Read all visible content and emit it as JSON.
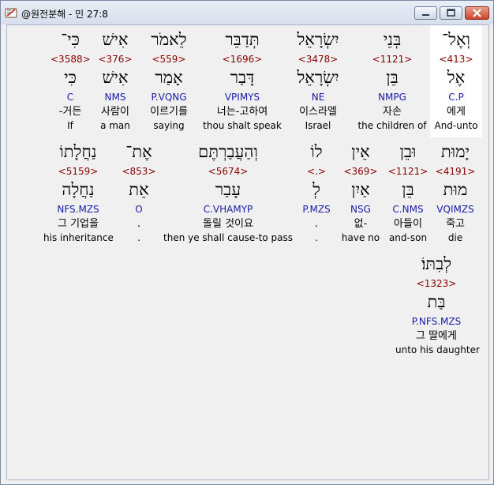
{
  "window": {
    "title": "@원전분해 - 민 27:8",
    "app_icon": "book-icon"
  },
  "rows": [
    {
      "words": [
        {
          "heb": "כִּי־",
          "num": "<3588>",
          "lemma": "כִּי",
          "morph": "C",
          "kor": "-거든",
          "eng": "If"
        },
        {
          "heb": "אִישׁ",
          "num": "<376>",
          "lemma": "אִישׁ",
          "morph": "NMS",
          "kor": "사람이",
          "eng": "a man"
        },
        {
          "heb": "לֵאמֹר",
          "num": "<559>",
          "lemma": "אָמַר",
          "morph": "P.VQNG",
          "kor": "이르기를",
          "eng": "saying"
        },
        {
          "heb": "תְּדַבֵּר",
          "num": "<1696>",
          "lemma": "דָּבַר",
          "morph": "VPIMYS",
          "kor": "너는-고하여",
          "eng": "thou shalt speak"
        },
        {
          "heb": "יִשְׂרָאֵל",
          "num": "<3478>",
          "lemma": "יִשְׂרָאֵל",
          "morph": "NE",
          "kor": "이스라엘",
          "eng": "Israel"
        },
        {
          "heb": "בְּנֵי",
          "num": "<1121>",
          "lemma": "בֵּן",
          "morph": "NMPG",
          "kor": "자손",
          "eng": "the children of"
        },
        {
          "heb": "וְאֶל־",
          "num": "<413>",
          "lemma": "אֶל",
          "morph": "C.P",
          "kor": "에게",
          "eng": "And-unto"
        }
      ]
    },
    {
      "words": [
        {
          "heb": "נַחֲלָתוֹ",
          "num": "<5159>",
          "lemma": "נַחֲלָה",
          "morph": "NFS.MZS",
          "kor": "그 기업을",
          "eng": "his inheritance"
        },
        {
          "heb": "אֶת־",
          "num": "<853>",
          "lemma": "אֵת",
          "morph": "O",
          "kor": ".",
          "eng": "."
        },
        {
          "heb": "וְהַעֲבַרְתֶּם",
          "num": "<5674>",
          "lemma": "עָבַר",
          "morph": "C.VHAMYP",
          "kor": "돌릴 것이요",
          "eng": "then ye shall cause-to pass"
        },
        {
          "heb": "לוֹ",
          "num": "<.>",
          "lemma": "לְ",
          "morph": "P.MZS",
          "kor": ".",
          "eng": "."
        },
        {
          "heb": "אֵין",
          "num": "<369>",
          "lemma": "אַיִן",
          "morph": "NSG",
          "kor": "없-",
          "eng": "have no"
        },
        {
          "heb": "וּבֵן",
          "num": "<1121>",
          "lemma": "בֵּן",
          "morph": "C.NMS",
          "kor": "아들이",
          "eng": "and-son"
        },
        {
          "heb": "יָמוּת",
          "num": "<4191>",
          "lemma": "מוּת",
          "morph": "VQIMZS",
          "kor": "죽고",
          "eng": "die"
        }
      ]
    },
    {
      "words": [
        {
          "heb": "לְבִתּוֹ׃",
          "num": "<1323>",
          "lemma": "בַּת",
          "morph": "P.NFS.MZS",
          "kor": "그 딸에게",
          "eng": "unto his daughter"
        }
      ]
    }
  ]
}
